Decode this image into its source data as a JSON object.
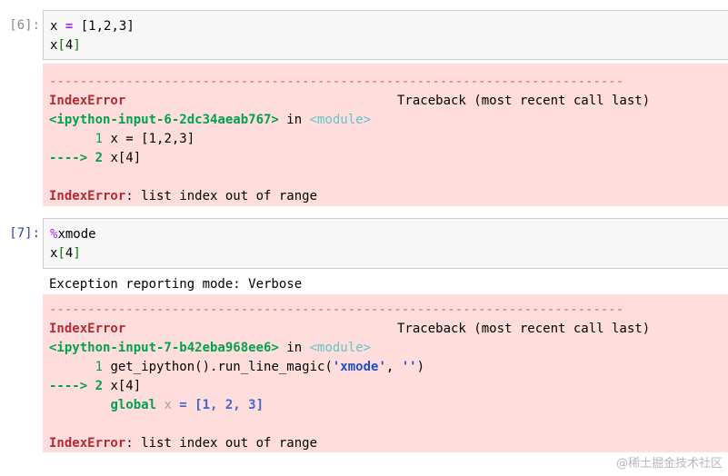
{
  "cell6": {
    "prompt": "[6]:",
    "code_line1": [
      "x ",
      "=",
      " [",
      "1",
      ",",
      "2",
      ",",
      "3",
      "]"
    ],
    "code_line2": [
      "x",
      "[",
      "4",
      "]"
    ],
    "error": {
      "dashes": "---------------------------------------------------------------------------",
      "name": "IndexError",
      "traceback_label": "Traceback (most recent call last)",
      "file": "<ipython-input-6-2dc34aeab767>",
      "in_word": " in ",
      "module": "<module>",
      "line1_prefix": "      1 ",
      "line1_code": "x = [1,2,3]",
      "line2_arrow": "----> 2 ",
      "line2_code": "x[4]",
      "final_name": "IndexError",
      "final_msg": ": list index out of range"
    }
  },
  "cell7": {
    "prompt": "[7]:",
    "code_line1_magic": "%",
    "code_line1_rest": "xmode",
    "code_line2": [
      "x",
      "[",
      "4",
      "]"
    ],
    "output_text": "Exception reporting mode: Verbose",
    "error": {
      "dashes": "---------------------------------------------------------------------------",
      "name": "IndexError",
      "traceback_label": "Traceback (most recent call last)",
      "file": "<ipython-input-7-b42eba968ee6>",
      "in_word": " in ",
      "module": "<module>",
      "line1_prefix": "      1 ",
      "line1_code_a": "get_ipython",
      "line1_code_b": "().run_line_magic(",
      "line1_str1": "'xmode'",
      "line1_sep": ", ",
      "line1_str2": "''",
      "line1_close": ")",
      "line2_arrow": "----> 2 ",
      "line2_code": "x[4]",
      "global_indent": "        ",
      "global_kw": "global",
      "global_var": " x",
      "global_eq": " =",
      "global_val": " [1, 2, 3]",
      "final_name": "IndexError",
      "final_msg": ": list index out of range"
    }
  },
  "watermark": "@稀土掘金技术社区"
}
